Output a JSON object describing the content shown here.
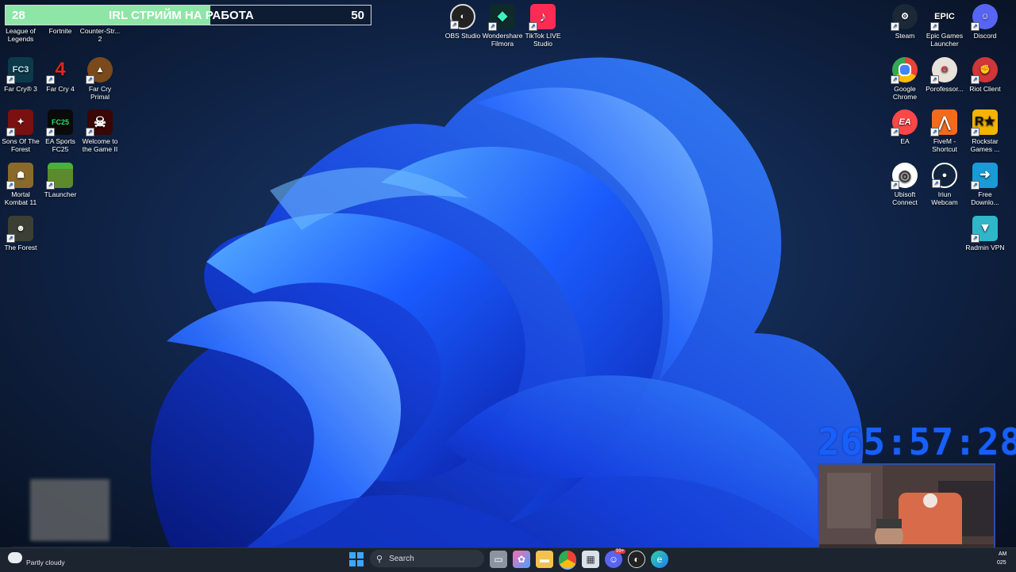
{
  "stream": {
    "goal_left": "28",
    "goal_title": "IRL СТРИЙМ НА РАБОТА",
    "goal_right": "50",
    "goal_progress": 0.56,
    "timer": "265:57:28"
  },
  "desktop_icons": {
    "league": "League of Legends",
    "fortnite": "Fortnite",
    "counter_strike": "Counter-Str... 2",
    "far_cry3": "Far Cry® 3",
    "far_cry4": "Far Cry 4",
    "far_cry_primal": "Far Cry Primal",
    "sons_forest": "Sons Of The Forest",
    "ea_fc25": "EA Sports FC25",
    "welcome_game": "Welcome to the Game II",
    "mortal_kombat": "Mortal Kombat 11",
    "tlauncher": "TLauncher",
    "the_forest": "The Forest",
    "obs": "OBS Studio",
    "filmora": "Wondershare Filmora",
    "tiktok_live": "TikTok LIVE Studio",
    "steam": "Steam",
    "epic": "Epic Games Launcher",
    "discord": "Discord",
    "chrome": "Google Chrome",
    "porofessor": "Porofessor...",
    "riot": "Riot Client",
    "ea": "EA",
    "fivem": "FiveM - Shortcut",
    "rockstar": "Rockstar Games ...",
    "ubisoft": "Ubisoft Connect",
    "iriun": "Iriun Webcam",
    "free_download": "Free Downlo...",
    "radmin": "Radmin VPN"
  },
  "icon_glyphs": {
    "far_cry3": "FC3",
    "far_cry4": "4",
    "ea_fc25": "FC25",
    "epic": "EPIC",
    "ea": "EA"
  },
  "taskbar": {
    "search_placeholder": "Search",
    "weather": "Partly cloudy",
    "clock_time_partial": "AM",
    "clock_date_partial": "025",
    "discord_badge": "99+"
  }
}
